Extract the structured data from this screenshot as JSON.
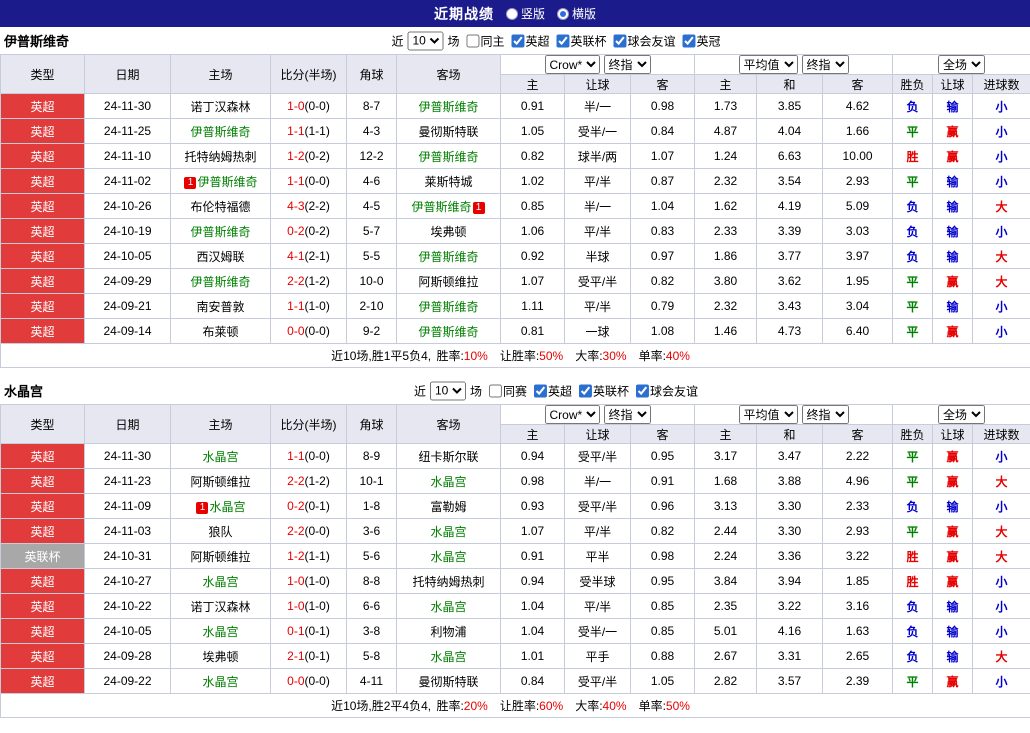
{
  "topbar": {
    "title": "近期战绩",
    "layout_options": [
      {
        "label": "竖版",
        "selected": false
      },
      {
        "label": "横版",
        "selected": true
      }
    ]
  },
  "colors": {
    "win": "#e60000",
    "draw": "#008000",
    "loss": "#0000cc",
    "score": "#e60000",
    "team": "#008000",
    "league": {
      "英超": "#e13b3b",
      "英联杯": "#a8a8a8"
    }
  },
  "column_headers": [
    "类型",
    "日期",
    "主场",
    "比分(半场)",
    "角球",
    "客场",
    "主",
    "让球",
    "客",
    "主",
    "和",
    "客",
    "胜负",
    "让球",
    "进球数"
  ],
  "tables": [
    {
      "team": "伊普斯维奇",
      "filter": {
        "prefix": "近",
        "count": "10",
        "suffix": "场",
        "checkboxes": [
          {
            "label": "同主",
            "checked": false
          },
          {
            "label": "英超",
            "checked": true
          },
          {
            "label": "英联杯",
            "checked": true
          },
          {
            "label": "球会友谊",
            "checked": true
          },
          {
            "label": "英冠",
            "checked": true
          }
        ]
      },
      "header_selects": {
        "asia": [
          "Crow*",
          "终指"
        ],
        "euro": [
          "平均值",
          "终指"
        ],
        "scope": [
          "全场"
        ]
      },
      "rows": [
        {
          "league": "英超",
          "date": "24-11-30",
          "home": "诺丁汉森林",
          "home_team": false,
          "score": "1-0",
          "half": "(0-0)",
          "corner": "8-7",
          "away": "伊普斯维奇",
          "away_team": true,
          "asia": [
            "0.91",
            "半/一",
            "0.98"
          ],
          "euro": [
            "1.73",
            "3.85",
            "4.62"
          ],
          "outcome": "负",
          "cover": "输",
          "goals": "小"
        },
        {
          "league": "英超",
          "date": "24-11-25",
          "home": "伊普斯维奇",
          "home_team": true,
          "score": "1-1",
          "half": "(1-1)",
          "corner": "4-3",
          "away": "曼彻斯特联",
          "away_team": false,
          "asia": [
            "1.05",
            "受半/一",
            "0.84"
          ],
          "euro": [
            "4.87",
            "4.04",
            "1.66"
          ],
          "outcome": "平",
          "cover": "赢",
          "goals": "小"
        },
        {
          "league": "英超",
          "date": "24-11-10",
          "home": "托特纳姆热刺",
          "home_team": false,
          "score": "1-2",
          "half": "(0-2)",
          "corner": "12-2",
          "away": "伊普斯维奇",
          "away_team": true,
          "asia": [
            "0.82",
            "球半/两",
            "1.07"
          ],
          "euro": [
            "1.24",
            "6.63",
            "10.00"
          ],
          "outcome": "胜",
          "cover": "赢",
          "goals": "小"
        },
        {
          "league": "英超",
          "date": "24-11-02",
          "home": "伊普斯维奇",
          "home_team": true,
          "home_badge": {
            "text": "1",
            "pos": "before"
          },
          "score": "1-1",
          "half": "(0-0)",
          "corner": "4-6",
          "away": "莱斯特城",
          "away_team": false,
          "asia": [
            "1.02",
            "平/半",
            "0.87"
          ],
          "euro": [
            "2.32",
            "3.54",
            "2.93"
          ],
          "outcome": "平",
          "cover": "输",
          "goals": "小"
        },
        {
          "league": "英超",
          "date": "24-10-26",
          "home": "布伦特福德",
          "home_team": false,
          "score": "4-3",
          "half": "(2-2)",
          "corner": "4-5",
          "away": "伊普斯维奇",
          "away_team": true,
          "away_badge": {
            "text": "1",
            "pos": "after"
          },
          "asia": [
            "0.85",
            "半/一",
            "1.04"
          ],
          "euro": [
            "1.62",
            "4.19",
            "5.09"
          ],
          "outcome": "负",
          "cover": "输",
          "goals": "大"
        },
        {
          "league": "英超",
          "date": "24-10-19",
          "home": "伊普斯维奇",
          "home_team": true,
          "score": "0-2",
          "half": "(0-2)",
          "corner": "5-7",
          "away": "埃弗顿",
          "away_team": false,
          "asia": [
            "1.06",
            "平/半",
            "0.83"
          ],
          "euro": [
            "2.33",
            "3.39",
            "3.03"
          ],
          "outcome": "负",
          "cover": "输",
          "goals": "小"
        },
        {
          "league": "英超",
          "date": "24-10-05",
          "home": "西汉姆联",
          "home_team": false,
          "score": "4-1",
          "half": "(2-1)",
          "corner": "5-5",
          "away": "伊普斯维奇",
          "away_team": true,
          "asia": [
            "0.92",
            "半球",
            "0.97"
          ],
          "euro": [
            "1.86",
            "3.77",
            "3.97"
          ],
          "outcome": "负",
          "cover": "输",
          "goals": "大"
        },
        {
          "league": "英超",
          "date": "24-09-29",
          "home": "伊普斯维奇",
          "home_team": true,
          "score": "2-2",
          "half": "(1-2)",
          "corner": "10-0",
          "away": "阿斯顿维拉",
          "away_team": false,
          "asia": [
            "1.07",
            "受平/半",
            "0.82"
          ],
          "euro": [
            "3.80",
            "3.62",
            "1.95"
          ],
          "outcome": "平",
          "cover": "赢",
          "goals": "大"
        },
        {
          "league": "英超",
          "date": "24-09-21",
          "home": "南安普敦",
          "home_team": false,
          "score": "1-1",
          "half": "(1-0)",
          "corner": "2-10",
          "away": "伊普斯维奇",
          "away_team": true,
          "asia": [
            "1.11",
            "平/半",
            "0.79"
          ],
          "euro": [
            "2.32",
            "3.43",
            "3.04"
          ],
          "outcome": "平",
          "cover": "输",
          "goals": "小"
        },
        {
          "league": "英超",
          "date": "24-09-14",
          "home": "布莱顿",
          "home_team": false,
          "score": "0-0",
          "half": "(0-0)",
          "corner": "9-2",
          "away": "伊普斯维奇",
          "away_team": true,
          "asia": [
            "0.81",
            "一球",
            "1.08"
          ],
          "euro": [
            "1.46",
            "4.73",
            "6.40"
          ],
          "outcome": "平",
          "cover": "赢",
          "goals": "小"
        }
      ],
      "summary": {
        "prefix": "近10场,胜1平5负4,",
        "stats": [
          {
            "label": "胜率:",
            "value": "10%"
          },
          {
            "label": "让胜率:",
            "value": "50%"
          },
          {
            "label": "大率:",
            "value": "30%"
          },
          {
            "label": "单率:",
            "value": "40%"
          }
        ]
      }
    },
    {
      "team": "水晶宫",
      "filter": {
        "prefix": "近",
        "count": "10",
        "suffix": "场",
        "checkboxes": [
          {
            "label": "同赛",
            "checked": false
          },
          {
            "label": "英超",
            "checked": true
          },
          {
            "label": "英联杯",
            "checked": true
          },
          {
            "label": "球会友谊",
            "checked": true
          }
        ]
      },
      "header_selects": {
        "asia": [
          "Crow*",
          "终指"
        ],
        "euro": [
          "平均值",
          "终指"
        ],
        "scope": [
          "全场"
        ]
      },
      "rows": [
        {
          "league": "英超",
          "date": "24-11-30",
          "home": "水晶宫",
          "home_team": true,
          "score": "1-1",
          "half": "(0-0)",
          "corner": "8-9",
          "away": "纽卡斯尔联",
          "away_team": false,
          "asia": [
            "0.94",
            "受平/半",
            "0.95"
          ],
          "euro": [
            "3.17",
            "3.47",
            "2.22"
          ],
          "outcome": "平",
          "cover": "赢",
          "goals": "小"
        },
        {
          "league": "英超",
          "date": "24-11-23",
          "home": "阿斯顿维拉",
          "home_team": false,
          "score": "2-2",
          "half": "(1-2)",
          "corner": "10-1",
          "away": "水晶宫",
          "away_team": true,
          "asia": [
            "0.98",
            "半/一",
            "0.91"
          ],
          "euro": [
            "1.68",
            "3.88",
            "4.96"
          ],
          "outcome": "平",
          "cover": "赢",
          "goals": "大"
        },
        {
          "league": "英超",
          "date": "24-11-09",
          "home": "水晶宫",
          "home_team": true,
          "home_badge": {
            "text": "1",
            "pos": "before"
          },
          "score": "0-2",
          "half": "(0-1)",
          "corner": "1-8",
          "away": "富勒姆",
          "away_team": false,
          "asia": [
            "0.93",
            "受平/半",
            "0.96"
          ],
          "euro": [
            "3.13",
            "3.30",
            "2.33"
          ],
          "outcome": "负",
          "cover": "输",
          "goals": "小"
        },
        {
          "league": "英超",
          "date": "24-11-03",
          "home": "狼队",
          "home_team": false,
          "score": "2-2",
          "half": "(0-0)",
          "corner": "3-6",
          "away": "水晶宫",
          "away_team": true,
          "asia": [
            "1.07",
            "平/半",
            "0.82"
          ],
          "euro": [
            "2.44",
            "3.30",
            "2.93"
          ],
          "outcome": "平",
          "cover": "赢",
          "goals": "大"
        },
        {
          "league": "英联杯",
          "date": "24-10-31",
          "home": "阿斯顿维拉",
          "home_team": false,
          "score": "1-2",
          "half": "(1-1)",
          "corner": "5-6",
          "away": "水晶宫",
          "away_team": true,
          "asia": [
            "0.91",
            "平半",
            "0.98"
          ],
          "euro": [
            "2.24",
            "3.36",
            "3.22"
          ],
          "outcome": "胜",
          "cover": "赢",
          "goals": "大"
        },
        {
          "league": "英超",
          "date": "24-10-27",
          "home": "水晶宫",
          "home_team": true,
          "score": "1-0",
          "half": "(1-0)",
          "corner": "8-8",
          "away": "托特纳姆热刺",
          "away_team": false,
          "asia": [
            "0.94",
            "受半球",
            "0.95"
          ],
          "euro": [
            "3.84",
            "3.94",
            "1.85"
          ],
          "outcome": "胜",
          "cover": "赢",
          "goals": "小"
        },
        {
          "league": "英超",
          "date": "24-10-22",
          "home": "诺丁汉森林",
          "home_team": false,
          "score": "1-0",
          "half": "(1-0)",
          "corner": "6-6",
          "away": "水晶宫",
          "away_team": true,
          "asia": [
            "1.04",
            "平/半",
            "0.85"
          ],
          "euro": [
            "2.35",
            "3.22",
            "3.16"
          ],
          "outcome": "负",
          "cover": "输",
          "goals": "小"
        },
        {
          "league": "英超",
          "date": "24-10-05",
          "home": "水晶宫",
          "home_team": true,
          "score": "0-1",
          "half": "(0-1)",
          "corner": "3-8",
          "away": "利物浦",
          "away_team": false,
          "asia": [
            "1.04",
            "受半/一",
            "0.85"
          ],
          "euro": [
            "5.01",
            "4.16",
            "1.63"
          ],
          "outcome": "负",
          "cover": "输",
          "goals": "小"
        },
        {
          "league": "英超",
          "date": "24-09-28",
          "home": "埃弗顿",
          "home_team": false,
          "score": "2-1",
          "half": "(0-1)",
          "corner": "5-8",
          "away": "水晶宫",
          "away_team": true,
          "asia": [
            "1.01",
            "平手",
            "0.88"
          ],
          "euro": [
            "2.67",
            "3.31",
            "2.65"
          ],
          "outcome": "负",
          "cover": "输",
          "goals": "大"
        },
        {
          "league": "英超",
          "date": "24-09-22",
          "home": "水晶宫",
          "home_team": true,
          "score": "0-0",
          "half": "(0-0)",
          "corner": "4-11",
          "away": "曼彻斯特联",
          "away_team": false,
          "asia": [
            "0.84",
            "受平/半",
            "1.05"
          ],
          "euro": [
            "2.82",
            "3.57",
            "2.39"
          ],
          "outcome": "平",
          "cover": "赢",
          "goals": "小"
        }
      ],
      "summary": {
        "prefix": "近10场,胜2平4负4,",
        "stats": [
          {
            "label": "胜率:",
            "value": "20%"
          },
          {
            "label": "让胜率:",
            "value": "60%"
          },
          {
            "label": "大率:",
            "value": "40%"
          },
          {
            "label": "单率:",
            "value": "50%"
          }
        ]
      }
    }
  ]
}
